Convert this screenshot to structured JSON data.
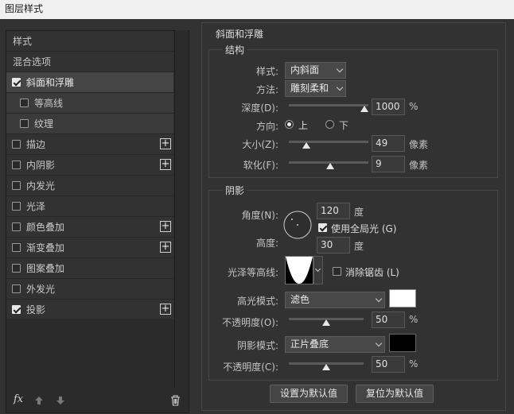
{
  "window": {
    "title": "图层样式"
  },
  "sidebar": {
    "items": [
      {
        "label": "样式",
        "checkbox": false,
        "checked": false,
        "plus": false
      },
      {
        "label": "混合选项",
        "checkbox": false,
        "checked": false,
        "plus": false
      },
      {
        "label": "斜面和浮雕",
        "checkbox": true,
        "checked": true,
        "plus": false
      },
      {
        "label": "等高线",
        "checkbox": true,
        "checked": false,
        "plus": false
      },
      {
        "label": "纹理",
        "checkbox": true,
        "checked": false,
        "plus": false
      },
      {
        "label": "描边",
        "checkbox": true,
        "checked": false,
        "plus": true
      },
      {
        "label": "内阴影",
        "checkbox": true,
        "checked": false,
        "plus": true
      },
      {
        "label": "内发光",
        "checkbox": true,
        "checked": false,
        "plus": false
      },
      {
        "label": "光泽",
        "checkbox": true,
        "checked": false,
        "plus": false
      },
      {
        "label": "颜色叠加",
        "checkbox": true,
        "checked": false,
        "plus": true
      },
      {
        "label": "渐变叠加",
        "checkbox": true,
        "checked": false,
        "plus": true
      },
      {
        "label": "图案叠加",
        "checkbox": true,
        "checked": false,
        "plus": false
      },
      {
        "label": "外发光",
        "checkbox": true,
        "checked": false,
        "plus": false
      },
      {
        "label": "投影",
        "checkbox": true,
        "checked": true,
        "plus": true
      }
    ],
    "footer": {
      "fx_label": "fx"
    }
  },
  "panel": {
    "title": "斜面和浮雕",
    "structure": {
      "legend": "结构",
      "style_label": "样式:",
      "style_value": "内斜面",
      "method_label": "方法:",
      "method_value": "雕刻柔和",
      "depth_label": "深度(D):",
      "depth_value": "1000",
      "depth_unit": "%",
      "depth_level": 1.0,
      "direction_label": "方向:",
      "dir_up": "上",
      "dir_down": "下",
      "size_label": "大小(Z):",
      "size_value": "49",
      "size_unit": "像素",
      "size_level": 0.2,
      "soften_label": "软化(F):",
      "soften_value": "9",
      "soften_unit": "像素",
      "soften_level": 0.55
    },
    "shading": {
      "legend": "阴影",
      "angle_label": "角度(N):",
      "angle_value": "120",
      "angle_unit": "度",
      "global_light_label": "使用全局光 (G)",
      "altitude_label": "高度:",
      "altitude_value": "30",
      "altitude_unit": "度",
      "gloss_label": "光泽等高线:",
      "antialias_label": "消除锯齿 (L)",
      "highlight_mode_label": "高光模式:",
      "highlight_mode_value": "滤色",
      "highlight_color": "#ffffff",
      "highlight_opacity_label": "不透明度(O):",
      "highlight_opacity_value": "50",
      "highlight_opacity_unit": "%",
      "highlight_opacity_level": 0.5,
      "shadow_mode_label": "阴影模式:",
      "shadow_mode_value": "正片叠底",
      "shadow_color": "#000000",
      "shadow_opacity_label": "不透明度(C):",
      "shadow_opacity_value": "50",
      "shadow_opacity_unit": "%",
      "shadow_opacity_level": 0.5
    },
    "buttons": {
      "set_default": "设置为默认值",
      "reset_default": "复位为默认值"
    }
  }
}
